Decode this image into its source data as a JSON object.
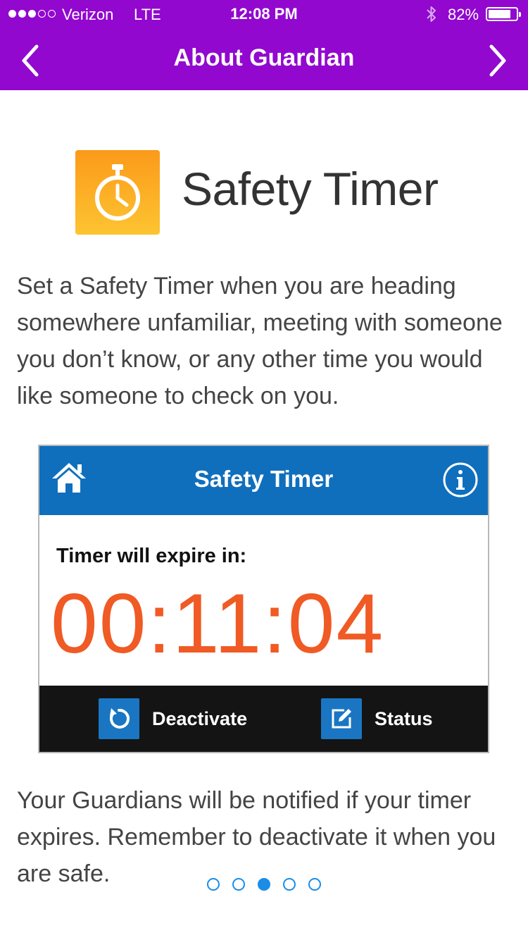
{
  "status_bar": {
    "carrier": "Verizon",
    "network": "LTE",
    "time": "12:08 PM",
    "battery_percent": "82%",
    "battery_level": 0.82,
    "signal_bars_filled": 3,
    "signal_bars_total": 5
  },
  "nav": {
    "title": "About Guardian",
    "back_icon": "chevron-left-icon",
    "forward_icon": "chevron-right-icon"
  },
  "feature": {
    "icon": "stopwatch-icon",
    "title": "Safety Timer",
    "description": "Set a Safety Timer when you are heading somewhere unfamiliar, meeting with someone you don’t know, or any other time you would like someone to check on you."
  },
  "preview": {
    "header_title": "Safety Timer",
    "home_icon": "home-icon",
    "info_icon": "info-icon",
    "label": "Timer will expire in:",
    "countdown": "00:11:04",
    "buttons": [
      {
        "label": "Deactivate",
        "icon": "undo-icon"
      },
      {
        "label": "Status",
        "icon": "edit-icon"
      }
    ],
    "colors": {
      "header": "#0f6fbd",
      "countdown": "#f05a24",
      "footer": "#141414"
    }
  },
  "footer_text": "Your Guardians will be notified if your timer expires. Remember to deactivate it when you are safe.",
  "pager": {
    "count": 5,
    "active_index": 2
  },
  "colors": {
    "accent": "#9208cf",
    "pager": "#1b8de6"
  }
}
